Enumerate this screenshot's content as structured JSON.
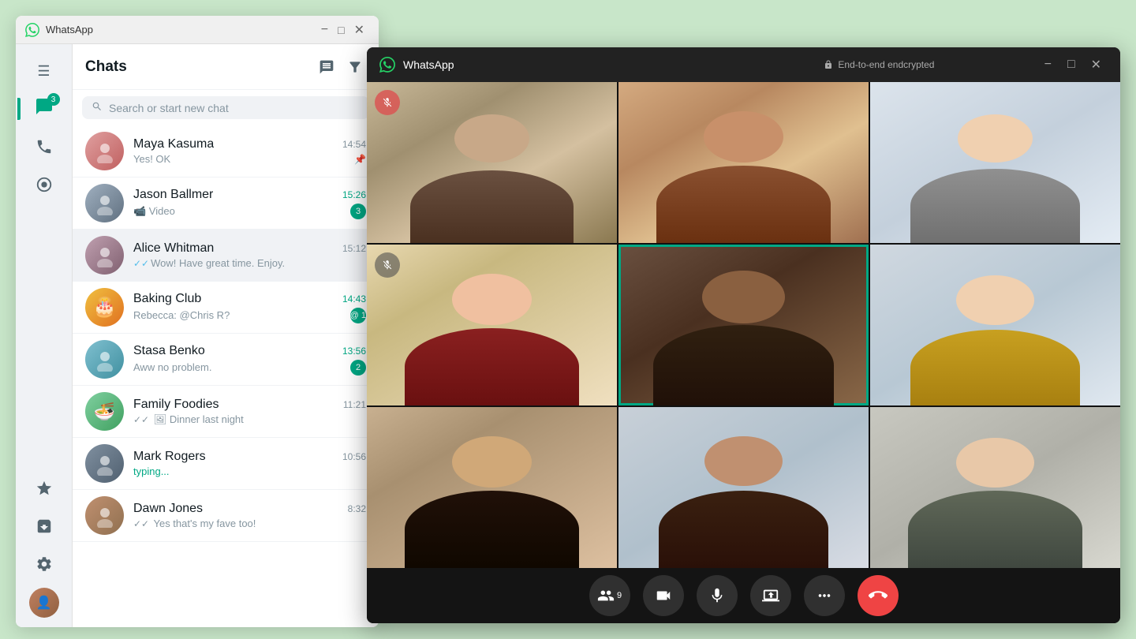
{
  "mainWindow": {
    "title": "WhatsApp",
    "titleBarButtons": [
      "minimize",
      "maximize",
      "close"
    ]
  },
  "sidebar": {
    "icons": [
      {
        "name": "menu-icon",
        "symbol": "☰",
        "active": false
      },
      {
        "name": "chats-icon",
        "symbol": "💬",
        "active": true,
        "badge": 3
      },
      {
        "name": "calls-icon",
        "symbol": "📞",
        "active": false
      },
      {
        "name": "status-icon",
        "symbol": "◎",
        "active": false
      }
    ],
    "bottomIcons": [
      {
        "name": "starred-icon",
        "symbol": "★",
        "active": false
      },
      {
        "name": "archived-icon",
        "symbol": "🗄",
        "active": false
      },
      {
        "name": "settings-icon",
        "symbol": "⚙",
        "active": false
      }
    ]
  },
  "chatsPanel": {
    "title": "Chats",
    "newChatIcon": "✏",
    "filterIcon": "☰",
    "searchPlaceholder": "Search or start new chat"
  },
  "chatList": [
    {
      "id": "maya",
      "name": "Maya Kasuma",
      "time": "14:54",
      "preview": "Yes! OK",
      "pinned": true,
      "avatarColor": "av-maya",
      "unread": 0,
      "timeUnread": false
    },
    {
      "id": "jason",
      "name": "Jason Ballmer",
      "time": "15:26",
      "preview": "📹 Video",
      "unread": 3,
      "avatarColor": "av-jason",
      "timeUnread": true
    },
    {
      "id": "alice",
      "name": "Alice Whitman",
      "time": "15:12",
      "preview": "Wow! Have great time. Enjoy.",
      "unread": 0,
      "active": true,
      "avatarColor": "av-alice",
      "timeUnread": false,
      "doubleCheck": true
    },
    {
      "id": "baking",
      "name": "Baking Club",
      "time": "14:43",
      "preview": "Rebecca: @Chris R?",
      "unread": 1,
      "avatarColor": "av-baking",
      "timeUnread": true,
      "atMention": true
    },
    {
      "id": "stasa",
      "name": "Stasa Benko",
      "time": "13:56",
      "preview": "Aww no problem.",
      "unread": 2,
      "avatarColor": "av-stasa",
      "timeUnread": true
    },
    {
      "id": "family",
      "name": "Family Foodies",
      "time": "11:21",
      "preview": "Dinner last night",
      "unread": 0,
      "avatarColor": "av-family",
      "timeUnread": false,
      "doubleCheck": true
    },
    {
      "id": "mark",
      "name": "Mark Rogers",
      "time": "10:56",
      "preview": "typing...",
      "typing": true,
      "unread": 0,
      "avatarColor": "av-mark",
      "timeUnread": false
    },
    {
      "id": "dawn",
      "name": "Dawn Jones",
      "time": "8:32",
      "preview": "Yes that's my fave too!",
      "unread": 0,
      "avatarColor": "av-dawn",
      "timeUnread": false,
      "doubleCheck": true
    }
  ],
  "callWindow": {
    "title": "WhatsApp",
    "encryptedLabel": "End-to-end endcrypted",
    "participantCount": "9"
  },
  "callControls": [
    {
      "id": "participants",
      "symbol": "👥",
      "label": "9"
    },
    {
      "id": "video",
      "symbol": "📹",
      "label": ""
    },
    {
      "id": "mic",
      "symbol": "🎤",
      "label": ""
    },
    {
      "id": "screen",
      "symbol": "⬆",
      "label": ""
    },
    {
      "id": "more",
      "symbol": "⋯",
      "label": ""
    },
    {
      "id": "end-call",
      "symbol": "📵",
      "label": "",
      "danger": true
    }
  ],
  "videoParticipants": [
    {
      "id": 1,
      "muted": true,
      "activeSpeaker": false
    },
    {
      "id": 2,
      "muted": false,
      "activeSpeaker": false
    },
    {
      "id": 3,
      "muted": false,
      "activeSpeaker": false
    },
    {
      "id": 4,
      "muted": true,
      "activeSpeaker": false
    },
    {
      "id": 5,
      "muted": false,
      "activeSpeaker": true
    },
    {
      "id": 6,
      "muted": false,
      "activeSpeaker": false
    },
    {
      "id": 7,
      "muted": false,
      "activeSpeaker": false
    },
    {
      "id": 8,
      "muted": false,
      "activeSpeaker": false
    },
    {
      "id": 9,
      "muted": false,
      "activeSpeaker": false
    }
  ]
}
